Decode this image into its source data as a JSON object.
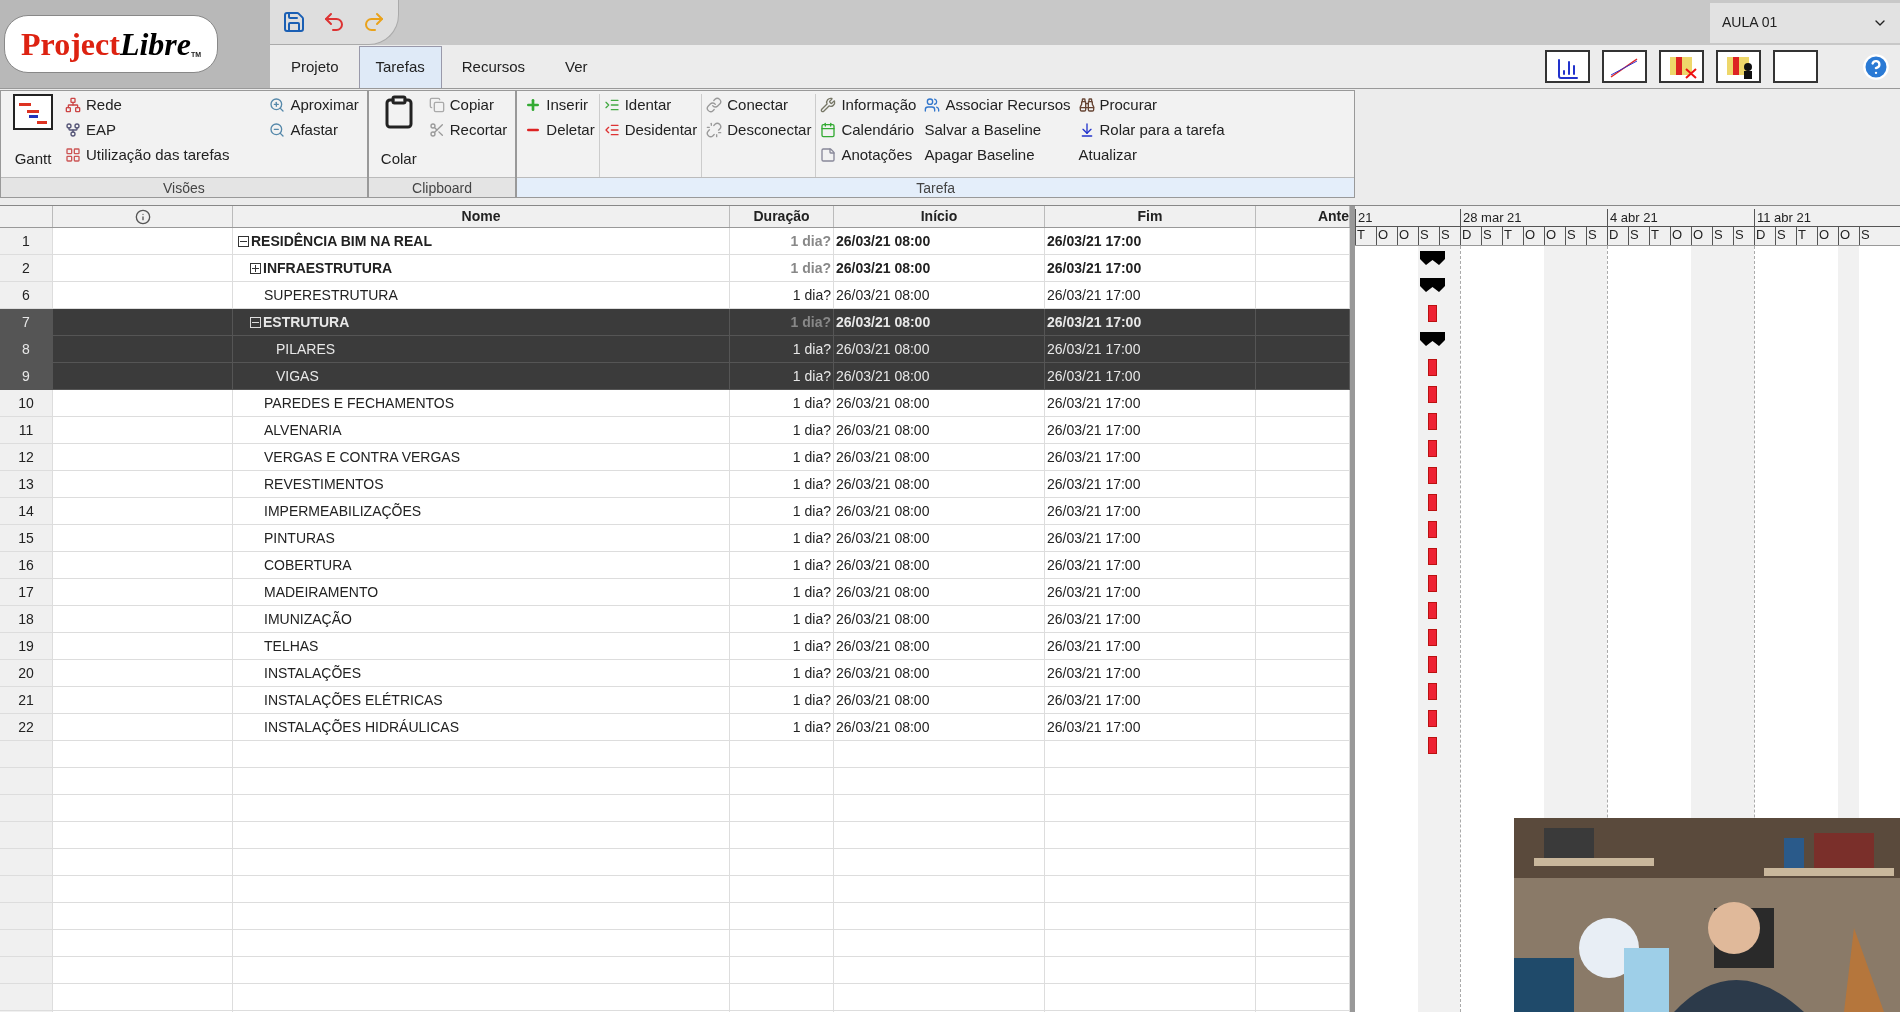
{
  "app": {
    "logo_main": "Project",
    "logo_italic": "Libre",
    "logo_tm": "TM"
  },
  "project_selector": {
    "value": "AULA 01"
  },
  "tabs": [
    {
      "label": "Projeto",
      "selected": false
    },
    {
      "label": "Tarefas",
      "selected": true
    },
    {
      "label": "Recursos",
      "selected": false
    },
    {
      "label": "Ver",
      "selected": false
    }
  ],
  "ribbon_groups": [
    {
      "title": "Visões",
      "columns": [
        [
          {
            "label": "Gantt",
            "kind": "large"
          }
        ],
        [
          {
            "label": "Rede",
            "kind": "small"
          },
          {
            "label": "EAP",
            "kind": "small"
          },
          {
            "label": "Utilização das tarefas",
            "kind": "small"
          }
        ],
        [
          {
            "label": "Aproximar",
            "kind": "small"
          },
          {
            "label": "Afastar",
            "kind": "small"
          }
        ]
      ]
    },
    {
      "title": "Clipboard",
      "columns": [
        [
          {
            "label": "Colar",
            "kind": "large"
          }
        ],
        [
          {
            "label": "Copiar",
            "kind": "small"
          },
          {
            "label": "Recortar",
            "kind": "small"
          }
        ]
      ]
    },
    {
      "title": "Tarefa",
      "columns": [
        [
          {
            "label": "Inserir",
            "kind": "small"
          },
          {
            "label": "Deletar",
            "kind": "small"
          }
        ],
        [
          {
            "label": "Identar",
            "kind": "small"
          },
          {
            "label": "Desidentar",
            "kind": "small"
          }
        ],
        [
          {
            "label": "Conectar",
            "kind": "small"
          },
          {
            "label": "Desconectar",
            "kind": "small"
          }
        ],
        [
          {
            "label": "Informação",
            "kind": "small"
          },
          {
            "label": "Calendário",
            "kind": "small"
          },
          {
            "label": "Anotações",
            "kind": "small"
          }
        ],
        [
          {
            "label": "Associar Recursos",
            "kind": "small"
          },
          {
            "label": "Salvar a Baseline",
            "kind": "small"
          },
          {
            "label": "Apagar Baseline",
            "kind": "small"
          }
        ],
        [
          {
            "label": "Procurar",
            "kind": "small"
          },
          {
            "label": "Rolar para a tarefa",
            "kind": "small"
          },
          {
            "label": "Atualizar",
            "kind": "small"
          }
        ]
      ]
    }
  ],
  "table": {
    "columns": [
      "Nome",
      "Duração",
      "Início",
      "Fim",
      "Ante"
    ],
    "rows": [
      {
        "id": "1",
        "name": "RESIDÊNCIA BIM NA REAL",
        "duration": "1 dia?",
        "start": "26/03/21 08:00",
        "end": "26/03/21 17:00",
        "expanded": true,
        "selected": false,
        "children": [
          {
            "id": "2",
            "name": "INFRAESTRUTURA",
            "duration": "1 dia?",
            "start": "26/03/21 08:00",
            "end": "26/03/21 17:00",
            "expanded": false,
            "selected": false
          },
          {
            "id": "6",
            "name": "SUPERESTRUTURA",
            "duration": "1 dia?",
            "start": "26/03/21 08:00",
            "end": "26/03/21 17:00",
            "selected": false
          },
          {
            "id": "7",
            "name": "ESTRUTURA",
            "duration": "1 dia?",
            "start": "26/03/21 08:00",
            "end": "26/03/21 17:00",
            "expanded": true,
            "selected": true,
            "children": [
              {
                "id": "8",
                "name": "PILARES",
                "duration": "1 dia?",
                "start": "26/03/21 08:00",
                "end": "26/03/21 17:00",
                "selected": true
              },
              {
                "id": "9",
                "name": "VIGAS",
                "duration": "1 dia?",
                "start": "26/03/21 08:00",
                "end": "26/03/21 17:00",
                "selected": true
              }
            ]
          },
          {
            "id": "10",
            "name": "PAREDES E FECHAMENTOS",
            "duration": "1 dia?",
            "start": "26/03/21 08:00",
            "end": "26/03/21 17:00",
            "selected": false
          },
          {
            "id": "11",
            "name": "ALVENARIA",
            "duration": "1 dia?",
            "start": "26/03/21 08:00",
            "end": "26/03/21 17:00",
            "selected": false
          },
          {
            "id": "12",
            "name": "VERGAS E CONTRA VERGAS",
            "duration": "1 dia?",
            "start": "26/03/21 08:00",
            "end": "26/03/21 17:00",
            "selected": false
          },
          {
            "id": "13",
            "name": "REVESTIMENTOS",
            "duration": "1 dia?",
            "start": "26/03/21 08:00",
            "end": "26/03/21 17:00",
            "selected": false
          },
          {
            "id": "14",
            "name": "IMPERMEABILIZAÇÕES",
            "duration": "1 dia?",
            "start": "26/03/21 08:00",
            "end": "26/03/21 17:00",
            "selected": false
          },
          {
            "id": "15",
            "name": "PINTURAS",
            "duration": "1 dia?",
            "start": "26/03/21 08:00",
            "end": "26/03/21 17:00",
            "selected": false
          },
          {
            "id": "16",
            "name": "COBERTURA",
            "duration": "1 dia?",
            "start": "26/03/21 08:00",
            "end": "26/03/21 17:00",
            "selected": false
          },
          {
            "id": "17",
            "name": "MADEIRAMENTO",
            "duration": "1 dia?",
            "start": "26/03/21 08:00",
            "end": "26/03/21 17:00",
            "selected": false
          },
          {
            "id": "18",
            "name": "IMUNIZAÇÃO",
            "duration": "1 dia?",
            "start": "26/03/21 08:00",
            "end": "26/03/21 17:00",
            "selected": false
          },
          {
            "id": "19",
            "name": "TELHAS",
            "duration": "1 dia?",
            "start": "26/03/21 08:00",
            "end": "26/03/21 17:00",
            "selected": false
          },
          {
            "id": "20",
            "name": "INSTALAÇÕES",
            "duration": "1 dia?",
            "start": "26/03/21 08:00",
            "end": "26/03/21 17:00",
            "selected": false
          },
          {
            "id": "21",
            "name": "INSTALAÇÕES ELÉTRICAS",
            "duration": "1 dia?",
            "start": "26/03/21 08:00",
            "end": "26/03/21 17:00",
            "selected": false
          },
          {
            "id": "22",
            "name": "INSTALAÇÕES HIDRÁULICAS",
            "duration": "1 dia?",
            "start": "26/03/21 08:00",
            "end": "26/03/21 17:00",
            "selected": false
          }
        ]
      }
    ]
  },
  "gantt": {
    "weeks": [
      {
        "label": "21",
        "days": [
          "T",
          "O",
          "O",
          "S",
          "S"
        ]
      },
      {
        "label": "28 mar 21",
        "days": [
          "D",
          "S",
          "T",
          "O",
          "O",
          "S",
          "S"
        ]
      },
      {
        "label": "4 abr 21",
        "days": [
          "D",
          "S",
          "T",
          "O",
          "O",
          "S",
          "S"
        ]
      },
      {
        "label": "11 abr 21",
        "days": [
          "D",
          "S",
          "T",
          "O",
          "O",
          "S"
        ]
      }
    ]
  }
}
